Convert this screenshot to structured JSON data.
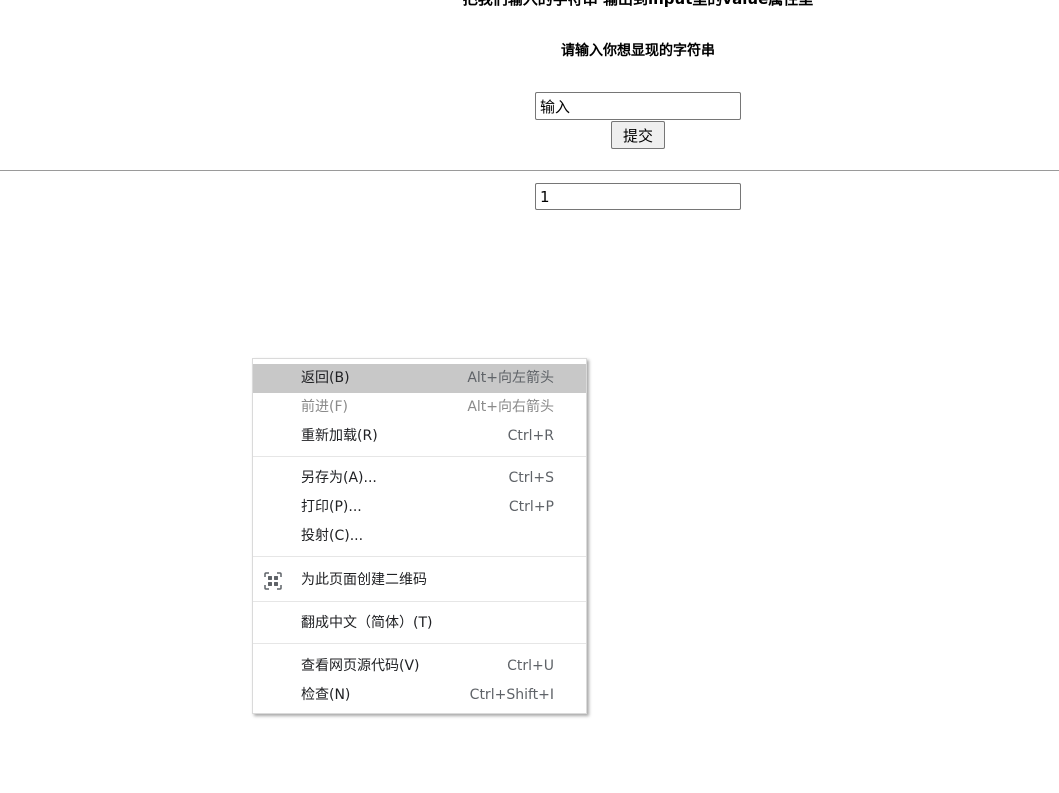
{
  "page": {
    "heading": "把我们输入的字符串 输出到input里的value属性里",
    "subheading": "请输入你想显现的字符串",
    "input_value": "输入",
    "submit_label": "提交",
    "result_value": "1"
  },
  "context_menu": {
    "items": [
      {
        "label": "返回(B)",
        "shortcut": "Alt+向左箭头"
      },
      {
        "label": "前进(F)",
        "shortcut": "Alt+向右箭头"
      },
      {
        "label": "重新加载(R)",
        "shortcut": "Ctrl+R"
      },
      {
        "label": "另存为(A)...",
        "shortcut": "Ctrl+S"
      },
      {
        "label": "打印(P)...",
        "shortcut": "Ctrl+P"
      },
      {
        "label": "投射(C)...",
        "shortcut": ""
      },
      {
        "label": "为此页面创建二维码",
        "shortcut": "",
        "icon": "qr-code-icon"
      },
      {
        "label": "翻成中文（简体）(T)",
        "shortcut": ""
      },
      {
        "label": "查看网页源代码(V)",
        "shortcut": "Ctrl+U"
      },
      {
        "label": "检查(N)",
        "shortcut": "Ctrl+Shift+I"
      }
    ],
    "highlight_color": "#c8c8c8"
  }
}
